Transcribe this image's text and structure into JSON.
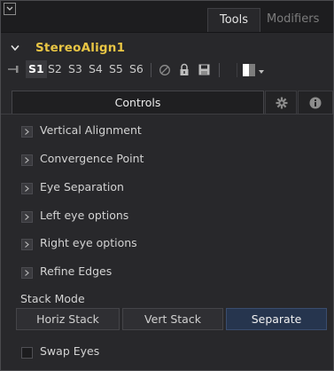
{
  "tabs": {
    "tools": "Tools",
    "modifiers": "Modifiers"
  },
  "node": {
    "title": "StereoAlign1"
  },
  "versions": [
    "S1",
    "S2",
    "S3",
    "S4",
    "S5",
    "S6"
  ],
  "active_version": "S1",
  "controls_tab": {
    "label": "Controls"
  },
  "sections": [
    "Vertical Alignment",
    "Convergence Point",
    "Eye Separation",
    "Left eye options",
    "Right eye options",
    "Refine Edges"
  ],
  "stack_mode": {
    "label": "Stack Mode",
    "options": [
      "Horiz Stack",
      "Vert Stack",
      "Separate"
    ],
    "selected": "Separate"
  },
  "swap_eyes": {
    "label": "Swap Eyes",
    "checked": false
  },
  "colors": {
    "title": "#e8c544",
    "selected_button": "#26354e",
    "background": "#28282b"
  },
  "icons": [
    "collapse-icon",
    "chevron-down-icon",
    "pin-icon",
    "reset-icon",
    "lock-icon",
    "save-icon",
    "color-swatch-icon",
    "gear-icon",
    "info-icon",
    "expand-arrow-icon"
  ]
}
